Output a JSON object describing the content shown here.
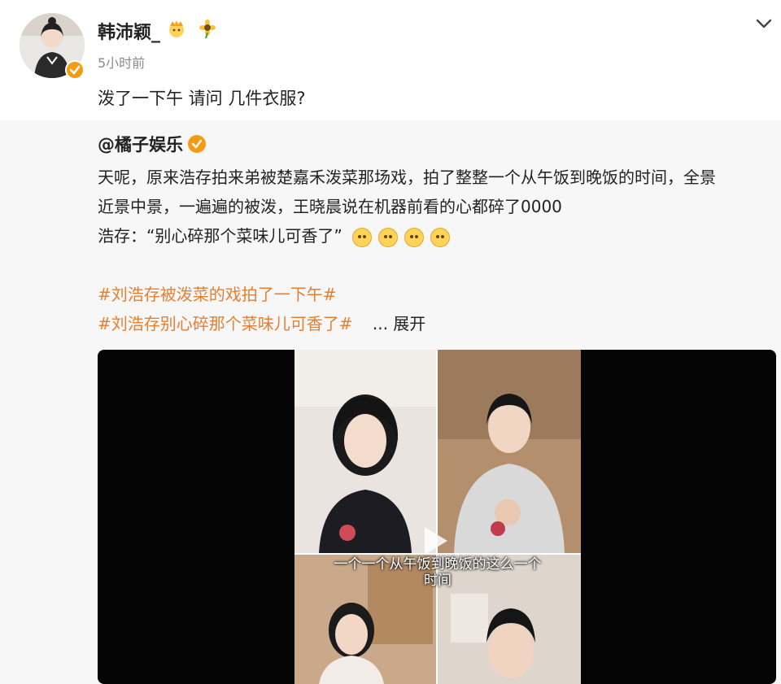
{
  "post": {
    "username": "韩沛颖_",
    "timestamp": "5小时前",
    "text": "泼了一下午 请问 几件衣服?",
    "icons": [
      "crown-icon",
      "sunflower-icon",
      "chevron-down-icon",
      "verified-badge-icon"
    ]
  },
  "repost": {
    "author": "@橘子娱乐",
    "body_lines": [
      "天呢，原来浩存拍来弟被楚嘉禾泼菜那场戏，拍了整整一个从午饭到晚饭的时间，全景",
      "近景中景，一遍遍的被泼，王晓晨说在机器前看的心都碎了0000",
      "浩存：“别心碎那个菜味儿可香了”"
    ],
    "hashtags": [
      "#刘浩存被泼菜的戏拍了一下午#",
      "#刘浩存别心碎那个菜味儿可香了#"
    ],
    "expand_label": "... 展开",
    "video": {
      "subtitle_line1": "一个一个从午饭到晚饭的这么一个",
      "subtitle_line2": "时间"
    }
  },
  "colors": {
    "accent_orange": "#e57f32",
    "verify_orange": "#f39c12",
    "repost_bg": "#f7f7f7"
  }
}
